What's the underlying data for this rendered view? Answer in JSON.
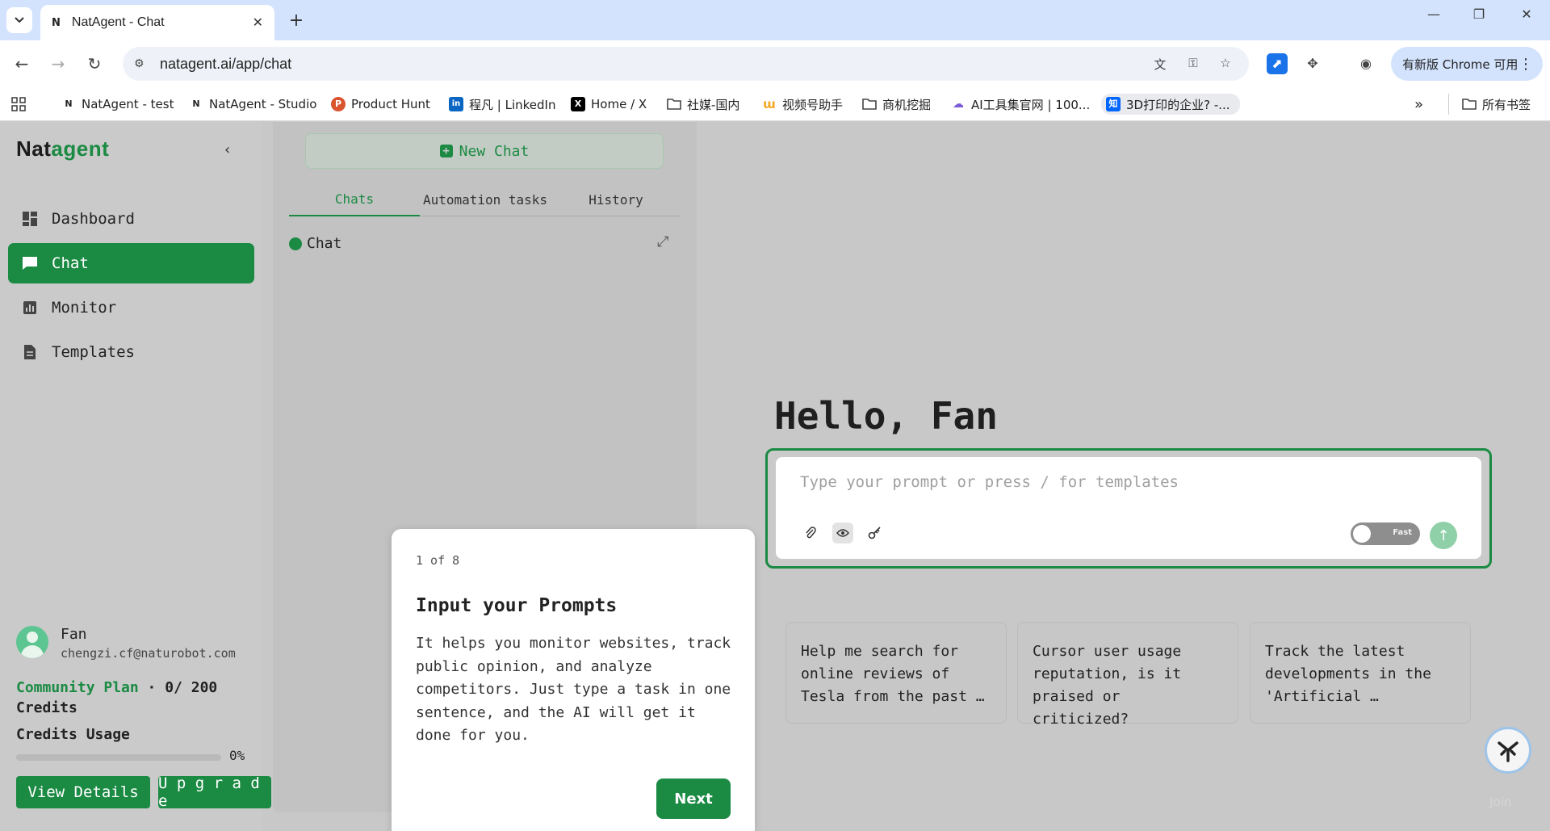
{
  "browser": {
    "tab_title": "NatAgent - Chat",
    "tab_favicon": "N",
    "url": "natagent.ai/app/chat",
    "update_label": "有新版 Chrome 可用",
    "bookmarks": [
      {
        "label": "NatAgent - test",
        "icon": "N"
      },
      {
        "label": "NatAgent - Studio",
        "icon": "N"
      },
      {
        "label": "Product Hunt",
        "icon": "P"
      },
      {
        "label": "程凡 | LinkedIn",
        "icon": "in"
      },
      {
        "label": "Home / X",
        "icon": "X"
      },
      {
        "label": "社媒-国内",
        "icon": "folder-icon"
      },
      {
        "label": "视频号助手",
        "icon": "wechat-channels-icon"
      },
      {
        "label": "商机挖掘",
        "icon": "folder-icon"
      },
      {
        "label": "AI工具集官网 | 100...",
        "icon": "ai-tools-icon"
      },
      {
        "label": "3D打印的企业?  -...",
        "icon": "知"
      }
    ],
    "all_bookmarks_label": "所有书签"
  },
  "sidebar": {
    "logo_nat": "Nat",
    "logo_agent": "agent",
    "nav": [
      {
        "label": "Dashboard",
        "icon": "dashboard-icon"
      },
      {
        "label": "Chat",
        "icon": "chat-icon",
        "active": true
      },
      {
        "label": "Monitor",
        "icon": "monitor-icon"
      },
      {
        "label": "Templates",
        "icon": "templates-icon"
      }
    ],
    "user": {
      "name": "Fan",
      "email": "chengzi.cf@naturobot.com"
    },
    "plan_name": "Community Plan",
    "plan_credits": " · 0/ 200 Credits",
    "usage_label": "Credits Usage",
    "usage_percent_text": "0%",
    "usage_fraction": 0,
    "view_details_label": "View Details",
    "upgrade_label": "U p g r a d e"
  },
  "chat_panel": {
    "new_chat_label": "New Chat",
    "tabs": [
      "Chats",
      "Automation tasks",
      "History"
    ],
    "active_tab": "Chats",
    "items": [
      {
        "label": "Chat"
      }
    ]
  },
  "main": {
    "greeting": "Hello, Fan",
    "prompt_placeholder": "Type your prompt or press / for templates",
    "mode_toggle_label": "Fast",
    "mode_toggle_on": false,
    "suggestions": [
      "Help me search for online reviews of Tesla from the past …",
      "Cursor user usage reputation, is it praised or criticized?",
      "Track the latest developments in the 'Artificial …"
    ],
    "watermark": "Join"
  },
  "onboarding": {
    "step": "1 of 8",
    "title": "Input your Prompts",
    "text": "It helps you monitor websites, track public opinion, and analyze competitors. Just type a task in one sentence, and the AI will get it done for you.",
    "next_label": "Next"
  },
  "colors": {
    "brand_green": "#1b8a43",
    "overlay_gray": "#c7c8c7",
    "chrome_blue": "#d3e3fd"
  }
}
